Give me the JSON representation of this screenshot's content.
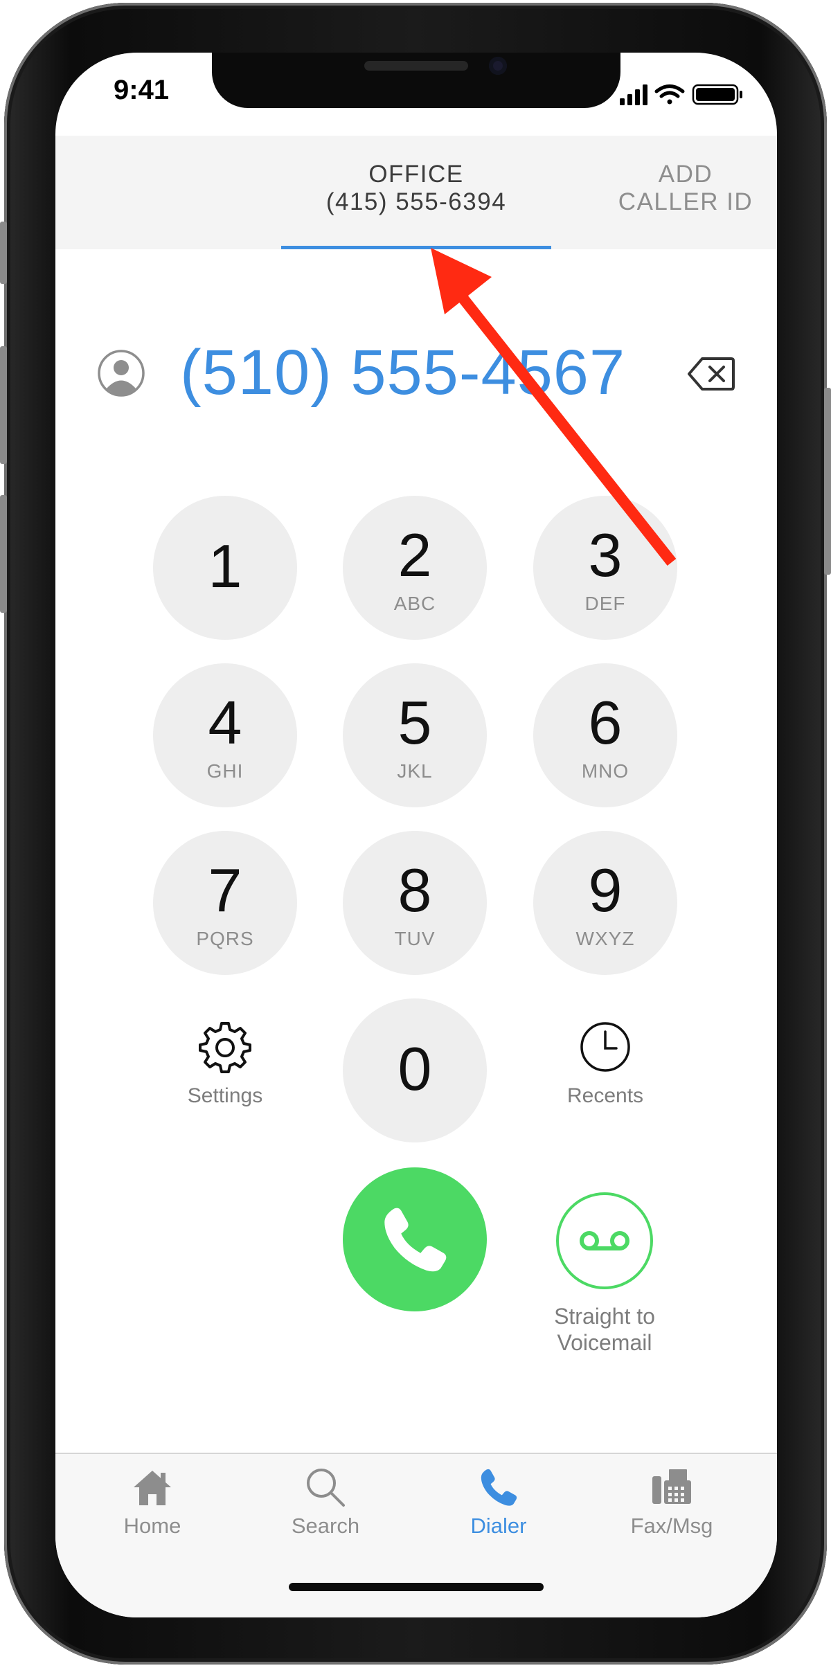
{
  "status_bar": {
    "time": "9:41"
  },
  "caller_id": {
    "selected_tab": {
      "line1": "OFFICE",
      "line2": "(415) 555-6394"
    },
    "add_tab": {
      "line1": "ADD",
      "line2": "CALLER ID"
    }
  },
  "dialer": {
    "number": "(510) 555-4567",
    "keys": [
      {
        "digit": "1",
        "letters": ""
      },
      {
        "digit": "2",
        "letters": "ABC"
      },
      {
        "digit": "3",
        "letters": "DEF"
      },
      {
        "digit": "4",
        "letters": "GHI"
      },
      {
        "digit": "5",
        "letters": "JKL"
      },
      {
        "digit": "6",
        "letters": "MNO"
      },
      {
        "digit": "7",
        "letters": "PQRS"
      },
      {
        "digit": "8",
        "letters": "TUV"
      },
      {
        "digit": "9",
        "letters": "WXYZ"
      },
      {
        "digit": "0",
        "letters": ""
      }
    ],
    "settings_label": "Settings",
    "recents_label": "Recents",
    "voicemail_label_line1": "Straight to",
    "voicemail_label_line2": "Voicemail"
  },
  "tab_bar": {
    "items": [
      {
        "label": "Home",
        "icon": "home-icon"
      },
      {
        "label": "Search",
        "icon": "search-icon"
      },
      {
        "label": "Dialer",
        "icon": "phone-icon"
      },
      {
        "label": "Fax/Msg",
        "icon": "fax-icon"
      }
    ],
    "active": "Dialer"
  },
  "colors": {
    "accent_blue": "#3d8ee0",
    "call_green": "#4cd964",
    "annotation_red": "#ff2a12",
    "key_background": "#eeeeee"
  }
}
